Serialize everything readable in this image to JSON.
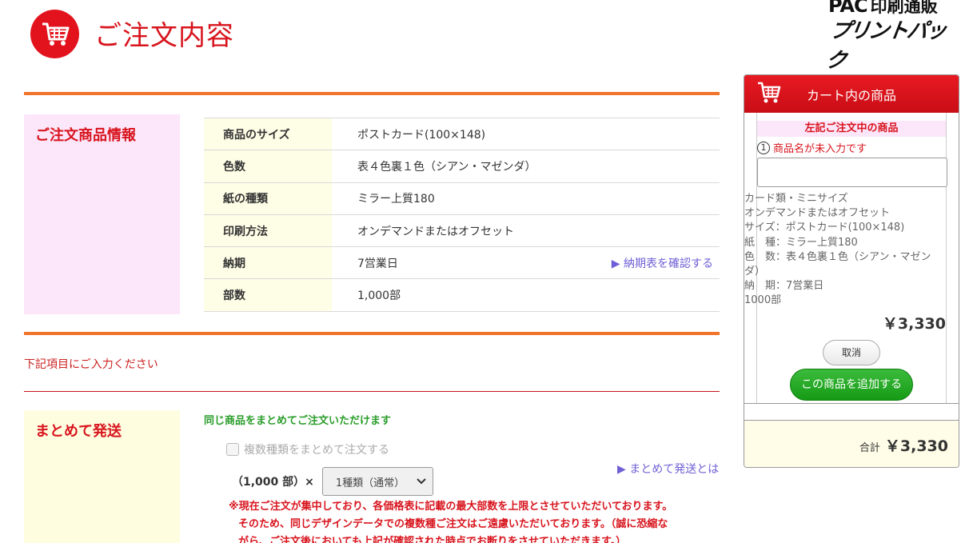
{
  "header": {
    "title": "ご注文内容",
    "logo_top": "PAC",
    "logo_tag": "印刷通販",
    "logo_bottom": "プリントパック"
  },
  "order_info": {
    "section_label": "ご注文商品情報",
    "rows": [
      {
        "label": "商品のサイズ",
        "value": "ポストカード(100×148)"
      },
      {
        "label": "色数",
        "value": "表４色裏１色（シアン・マゼンダ）"
      },
      {
        "label": "紙の種類",
        "value": "ミラー上質180"
      },
      {
        "label": "印刷方法",
        "value": "オンデマンドまたはオフセット"
      },
      {
        "label": "納期",
        "value": "7営業日",
        "link": "▶ 納期表を確認する"
      },
      {
        "label": "部数",
        "value": "1,000部"
      }
    ]
  },
  "input_notice": "下記項目にご入力ください",
  "bundle": {
    "section_label": "まとめて発送",
    "green_text": "同じ商品をまとめてご注文いただけます",
    "checkbox_label": "複数種類をまとめて注文する",
    "link": "▶ まとめて発送とは",
    "qty_label": "（1,000 部）×",
    "select_value": "1種類（通常）",
    "warning_line1": "※現在ご注文が集中しており、各価格表に記載の最大部数を上限とさせていただいております。",
    "warning_line2": "そのため、同じデザインデータでの複数種ご注文はご遠慮いただいております。（誠に恐縮な",
    "warning_line3": "がら、ご注文後においても上記が確認された時点でお断りをさせていただきます。）"
  },
  "cart": {
    "title": "カート内の商品",
    "subtitle": "左記ご注文中の商品",
    "item_number": "1",
    "item_name_placeholder": "商品名が未入力です",
    "details": [
      "カード類・ミニサイズ",
      "オンデマンドまたはオフセット",
      "サイズ：ポストカード(100×148)",
      "紙　種：ミラー上質180",
      "色　数：表４色裏１色（シアン・マゼンダ）",
      "納　期：7営業日",
      "1000部"
    ],
    "price": "￥3,330",
    "cancel_label": "取消",
    "add_label": "この商品を追加する",
    "total_label": "合計",
    "total_amount": "￥3,330"
  },
  "colors": {
    "brand_red": "#d8141d",
    "orange_rule": "#f2732a",
    "pink_bg": "#fce6fa",
    "cream_bg": "#fffde0",
    "green": "#2a9d2a",
    "link_purple": "#6e5fd6"
  },
  "icons": [
    "cart-icon",
    "cart-small-icon",
    "chevron-down-icon"
  ]
}
